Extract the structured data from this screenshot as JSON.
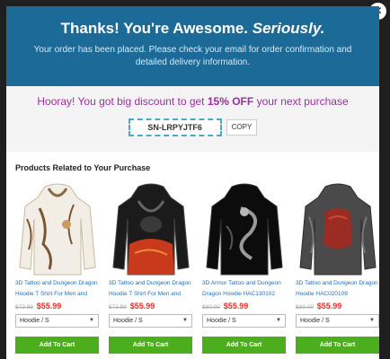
{
  "header": {
    "title_main": "Thanks! You're Awesome.",
    "title_emphasis": "Seriously.",
    "message": "Your order has been placed. Please check your email for order confirmation and detailed delivery information."
  },
  "discount": {
    "text_before": "Hooray! You got big discount to get",
    "highlight": "15% OFF",
    "text_after": "your next purchase",
    "coupon_code": "SN-LRPYJTF6",
    "copy_label": "COPY"
  },
  "close_label": "✕",
  "products_title": "Products Related to Your Purchase",
  "products": [
    {
      "name": "3D Tattoo and Dungeon Dragon Hoodie T Shirt For Men and",
      "old_price": "$72.99",
      "new_price": "$55.99",
      "variant": "Hoodie / S",
      "cta": "Add To Cart",
      "palette": "white-tattoo",
      "accent": "#9a6a3a"
    },
    {
      "name": "3D Tattoo and Dungeon Dragon Hoodie T Shirt For Men and",
      "old_price": "$72.99",
      "new_price": "$55.99",
      "variant": "Hoodie / S",
      "cta": "Add To Cart",
      "palette": "dark-fire",
      "accent": "#d2451e"
    },
    {
      "name": "3D Armor Tattoo and Dungeon Dragon Hoodie HAC130102",
      "old_price": "$80.00",
      "new_price": "$55.99",
      "variant": "Hoodie / S",
      "cta": "Add To Cart",
      "palette": "black-dragon",
      "accent": "#777777"
    },
    {
      "name": "3D Tattoo and Dungeon Dragon Hoodie HAC020109",
      "old_price": "$80.00",
      "new_price": "$55.99",
      "variant": "Hoodie / S",
      "cta": "Add To Cart",
      "palette": "grey-red",
      "accent": "#b8322a"
    }
  ],
  "colors": {
    "header_bg": "#1c6a98",
    "discount_text": "#9b2fa0",
    "price_red": "#e3302f",
    "cart_green": "#4cae1d"
  }
}
